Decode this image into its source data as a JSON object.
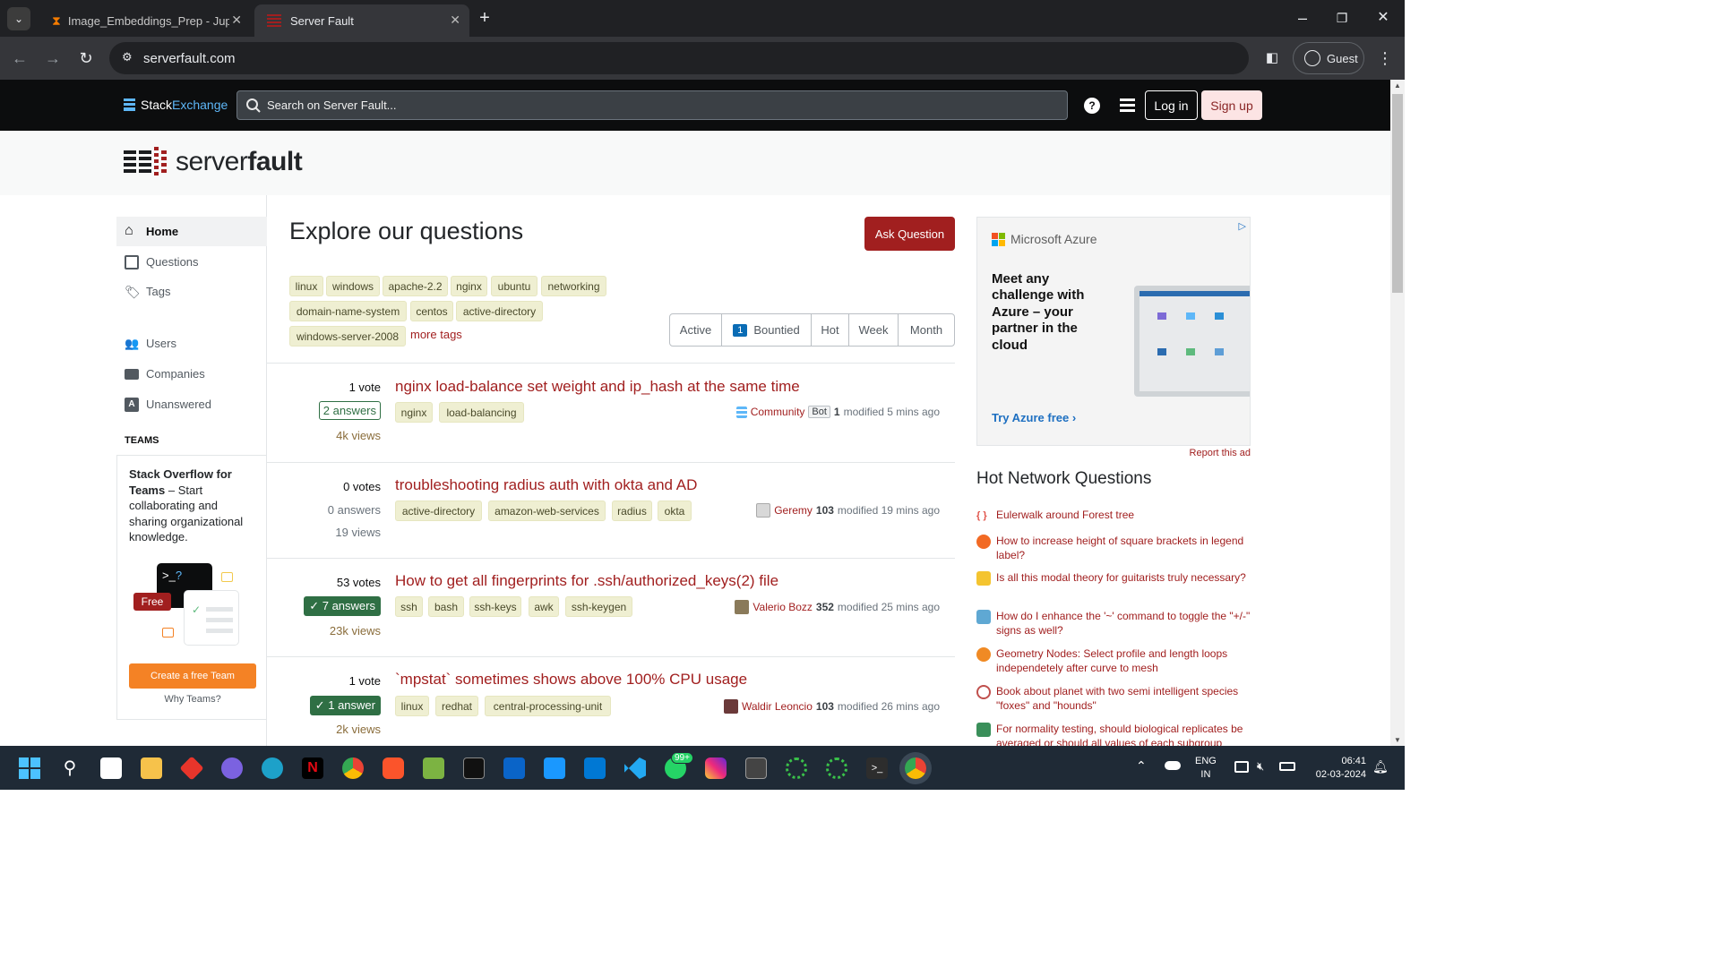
{
  "browser": {
    "tabs": [
      {
        "title": "Image_Embeddings_Prep - Jupy"
      },
      {
        "title": "Server Fault"
      }
    ],
    "url": "serverfault.com",
    "profile_label": "Guest"
  },
  "se_bar": {
    "logo_stack": "Stack",
    "logo_exchange": "Exchange",
    "search_placeholder": "Search on Server Fault...",
    "login_label": "Log in",
    "signup_label": "Sign up"
  },
  "site": {
    "logo_light": "server",
    "logo_bold": "fault"
  },
  "left_nav": {
    "items": [
      {
        "label": "Home"
      },
      {
        "label": "Questions"
      },
      {
        "label": "Tags"
      },
      {
        "label": "Users"
      },
      {
        "label": "Companies"
      },
      {
        "label": "Unanswered"
      }
    ],
    "teams_label": "TEAMS",
    "teams_bold": "Stack Overflow for Teams",
    "teams_text": " – Start collaborating and sharing organizational knowledge.",
    "teams_free": "Free",
    "teams_button": "Create a free Team",
    "why_teams": "Why Teams?"
  },
  "main": {
    "title": "Explore our questions",
    "ask_button": "Ask Question",
    "tags": [
      "linux",
      "windows",
      "apache-2.2",
      "nginx",
      "ubuntu",
      "networking",
      "domain-name-system",
      "centos",
      "active-directory",
      "windows-server-2008"
    ],
    "more_tags": "more tags",
    "filters": [
      {
        "label": "Active"
      },
      {
        "label": "Bountied",
        "badge": "1"
      },
      {
        "label": "Hot"
      },
      {
        "label": "Week"
      },
      {
        "label": "Month"
      }
    ],
    "questions": [
      {
        "votes": "1 vote",
        "answers": "2 answers",
        "views": "4k views",
        "title": "nginx load-balance set weight and ip_hash at the same time",
        "tags": [
          "nginx",
          "load-balancing"
        ],
        "user": "Community",
        "bot": "Bot",
        "rep": "1",
        "modified": "modified 5 mins ago"
      },
      {
        "votes": "0 votes",
        "answers": "0 answers",
        "views": "19 views",
        "title": "troubleshooting radius auth with okta and AD",
        "tags": [
          "active-directory",
          "amazon-web-services",
          "radius",
          "okta"
        ],
        "user": "Geremy",
        "rep": "103",
        "modified": "modified 19 mins ago"
      },
      {
        "votes": "53 votes",
        "answers": "✓ 7 answers",
        "views": "23k views",
        "title": "How to get all fingerprints for .ssh/authorized_keys(2) file",
        "tags": [
          "ssh",
          "bash",
          "ssh-keys",
          "awk",
          "ssh-keygen"
        ],
        "user": "Valerio Bozz",
        "rep": "352",
        "modified": "modified 25 mins ago"
      },
      {
        "votes": "1 vote",
        "answers": "✓ 1 answer",
        "views": "2k views",
        "title": "`mpstat` sometimes shows above 100% CPU usage",
        "tags": [
          "linux",
          "redhat",
          "central-processing-unit"
        ],
        "user": "Waldir Leoncio",
        "rep": "103",
        "modified": "modified 26 mins ago"
      }
    ]
  },
  "ad": {
    "brand": "Microsoft Azure",
    "headline": "Meet any challenge with Azure – your partner in the cloud",
    "cta": "Try Azure free ›",
    "report": "Report this ad"
  },
  "hnq": {
    "title": "Hot Network Questions",
    "items": [
      {
        "text": "Eulerwalk around Forest tree",
        "color": "#e0534a"
      },
      {
        "text": "How to increase height of square brackets in legend label?",
        "color": "#f26a24"
      },
      {
        "text": "Is all this modal theory for guitarists truly necessary?",
        "color": "#f4c430"
      },
      {
        "text": "How do I enhance the '~' command to toggle the \"+/-\" signs as well?",
        "color": "#5fa8d3"
      },
      {
        "text": "Geometry Nodes: Select profile and length loops independetely after curve to mesh",
        "color": "#f08a24"
      },
      {
        "text": "Book about planet with two semi intelligent species \"foxes\" and \"hounds\"",
        "color": "#c0504d"
      },
      {
        "text": "For normality testing, should biological replicates be averaged or should all values of each subgroup",
        "color": "#3a8f5a"
      }
    ]
  },
  "taskbar": {
    "lang_line1": "ENG",
    "lang_line2": "IN",
    "time": "06:41",
    "date": "02-03-2024",
    "whatsapp_badge": "99+"
  }
}
